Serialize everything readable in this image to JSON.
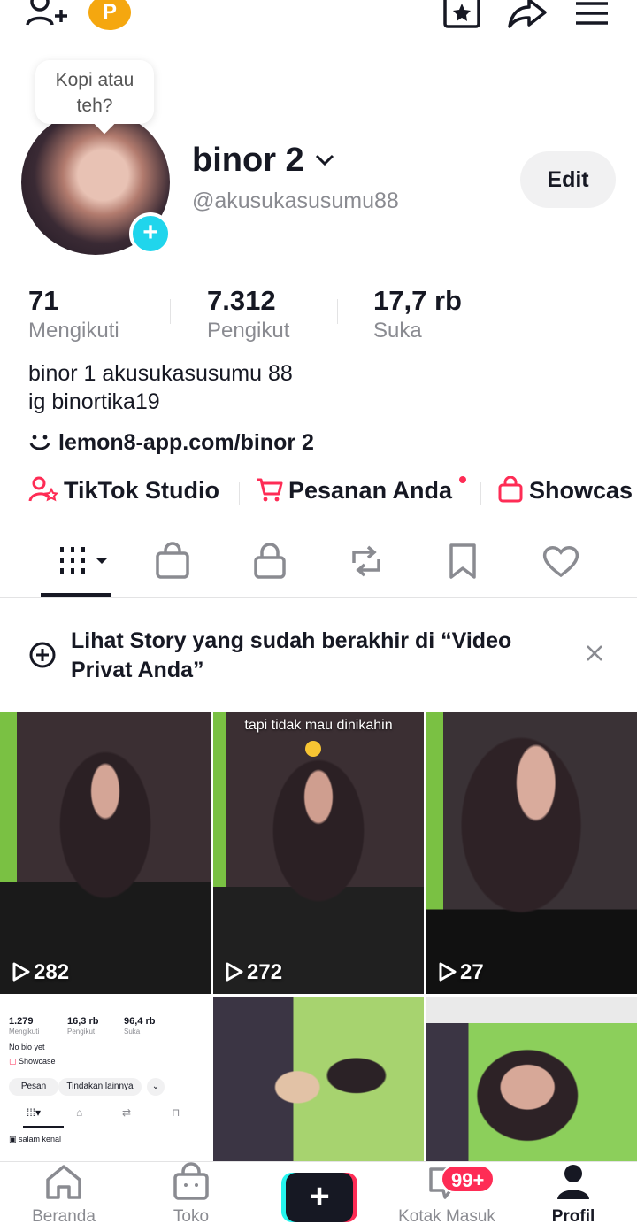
{
  "topbar": {
    "coin_letter": "P"
  },
  "profile": {
    "bubble_text": "Kopi atau teh?",
    "name": "binor 2",
    "handle": "@akusukasusumu88",
    "edit_label": "Edit"
  },
  "stats": [
    {
      "value": "71",
      "label": "Mengikuti"
    },
    {
      "value": "7.312",
      "label": "Pengikut"
    },
    {
      "value": "17,7 rb",
      "label": "Suka"
    }
  ],
  "bio": {
    "line1": "binor 1 akusukasusumu 88",
    "line2": "ig binortika19"
  },
  "link": "lemon8-app.com/binor 2",
  "shortcuts": {
    "studio": "TikTok Studio",
    "orders": "Pesanan Anda",
    "showcase": "Showcas"
  },
  "story_banner": {
    "text": "Lihat Story yang sudah berakhir di “Video Privat Anda”"
  },
  "videos": [
    {
      "views": "282"
    },
    {
      "views": "272",
      "caption": "tapi tidak mau dinikahin"
    },
    {
      "views": "27"
    }
  ],
  "mini_profile": {
    "stat1_value": "1.279",
    "stat1_label": "Mengikuti",
    "stat2_value": "16,3 rb",
    "stat2_label": "Pengikut",
    "stat3_value": "96,4 rb",
    "stat3_label": "Suka",
    "bio": "No bio yet",
    "showcase": "Showcase",
    "btn_message": "Pesan",
    "btn_more": "Tindakan lainnya",
    "pinned": "salam kenal"
  },
  "bottom_nav": {
    "home": "Beranda",
    "shop": "Toko",
    "inbox": "Kotak Masuk",
    "inbox_badge": "99+",
    "profile": "Profil"
  },
  "colors": {
    "accent": "#fe2c55",
    "cyan": "#25f4ee",
    "text": "#161823",
    "muted": "#8a8b91"
  }
}
